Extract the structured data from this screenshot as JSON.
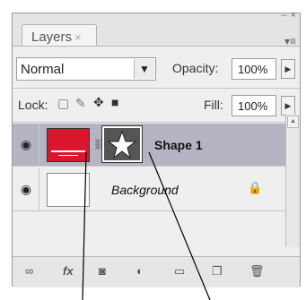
{
  "panel": {
    "minimize_glyph": "–",
    "close_glyph": "×",
    "tab_label": "Layers",
    "tab_close_glyph": "×",
    "menu_glyph": "▾≡"
  },
  "blend": {
    "mode": "Normal"
  },
  "opacity": {
    "label": "Opacity:",
    "value": "100%"
  },
  "lock": {
    "label": "Lock:"
  },
  "fill": {
    "label": "Fill:",
    "value": "100%"
  },
  "layers": [
    {
      "name": "Shape 1",
      "selected": true,
      "visible": true
    },
    {
      "name": "Background",
      "locked": true,
      "visible": true
    }
  ],
  "colors": {
    "shape_fill": "#d9162b",
    "selected_row": "#b4b4c3"
  },
  "bottom_icons": [
    "link-layers-icon",
    "fx-icon",
    "mask-icon",
    "adjustment-icon",
    "group-icon",
    "new-layer-icon",
    "trash-icon"
  ]
}
